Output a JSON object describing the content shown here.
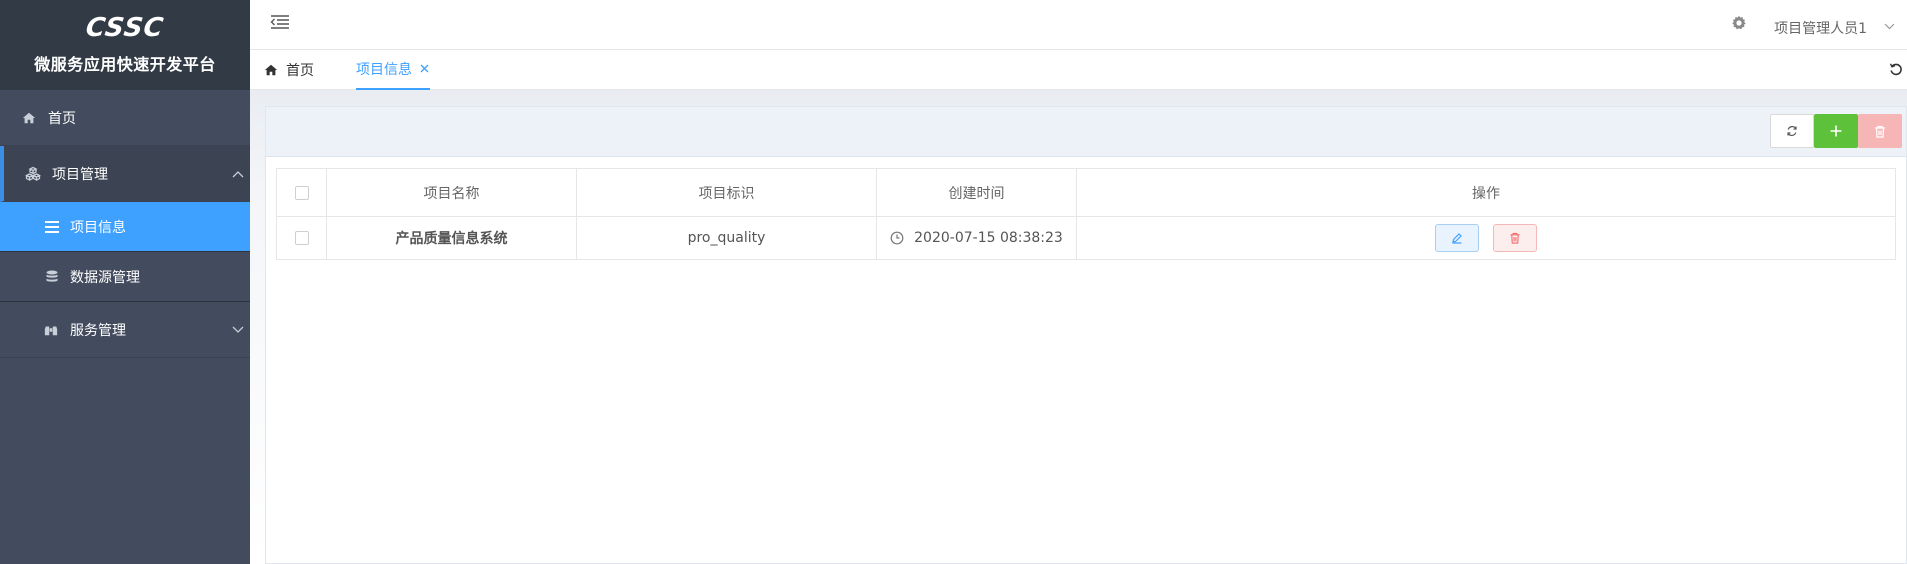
{
  "brand": {
    "logo_text": "CSSC",
    "title": "微服务应用快速开发平台"
  },
  "sidebar": {
    "items": [
      {
        "label": "首页",
        "icon": "home-icon"
      },
      {
        "label": "项目管理",
        "icon": "cubes-icon",
        "expanded": true,
        "children": [
          {
            "label": "项目信息",
            "icon": "list-icon",
            "active": true
          }
        ]
      },
      {
        "label": "数据源管理",
        "icon": "database-icon"
      },
      {
        "label": "服务管理",
        "icon": "binoculars-icon",
        "expanded": false
      }
    ]
  },
  "header": {
    "user_name": "项目管理人员1"
  },
  "tabs": {
    "home_label": "首页",
    "active_label": "项目信息"
  },
  "table": {
    "columns": [
      "项目名称",
      "项目标识",
      "创建时间",
      "操作"
    ],
    "rows": [
      {
        "name": "产品质量信息系统",
        "identifier": "pro_quality",
        "created": "2020-07-15 08:38:23"
      }
    ]
  },
  "colors": {
    "accent": "#3ea0ff",
    "sidebar_bg": "#434c5e",
    "brand_bg": "#323a45",
    "add_green": "#5ec13a",
    "delete_red": "#f6b6b6"
  }
}
